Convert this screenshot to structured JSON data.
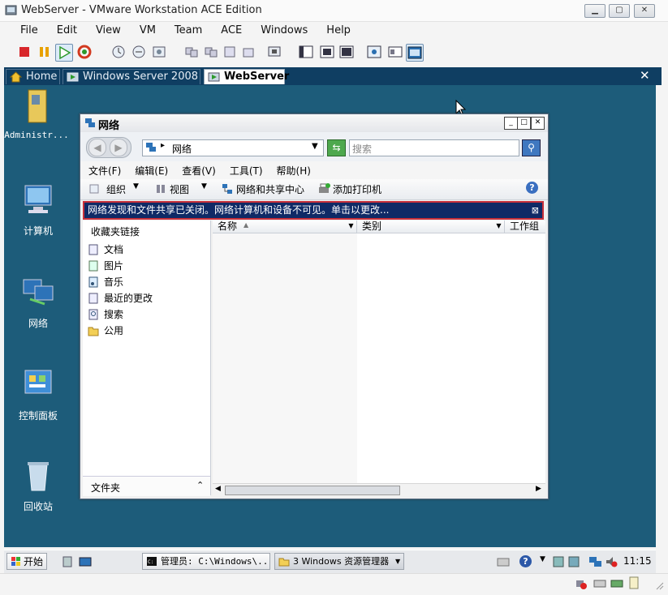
{
  "window": {
    "title": "WebServer - VMware Workstation ACE Edition"
  },
  "menu": [
    "File",
    "Edit",
    "View",
    "VM",
    "Team",
    "ACE",
    "Windows",
    "Help"
  ],
  "tabs": [
    {
      "label": "Home"
    },
    {
      "label": "Windows Server 2008"
    },
    {
      "label": "WebServer"
    }
  ],
  "desktop_icons": [
    {
      "label": "Administr..."
    },
    {
      "label": "计算机"
    },
    {
      "label": "网络"
    },
    {
      "label": "控制面板"
    },
    {
      "label": "回收站"
    }
  ],
  "explorer": {
    "title": "网络",
    "address": "网络",
    "search_placeholder": "搜索",
    "menu": [
      "文件(F)",
      "编辑(E)",
      "查看(V)",
      "工具(T)",
      "帮助(H)"
    ],
    "commands": [
      "组织",
      "视图",
      "网络和共享中心",
      "添加打印机"
    ],
    "infobar": "网络发现和文件共享已关闭。网络计算机和设备不可见。单击以更改...",
    "favorites_header": "收藏夹链接",
    "nav_items": [
      "文档",
      "图片",
      "音乐",
      "最近的更改",
      "搜索",
      "公用"
    ],
    "folders_label": "文件夹",
    "columns": [
      "名称",
      "类别",
      "工作组"
    ]
  },
  "taskbar": {
    "start": "开始",
    "tasks": [
      "管理员: C:\\Windows\\...",
      "3 Windows 资源管理器"
    ],
    "time": "11:15"
  },
  "colors": {
    "desktop": "#1d5c7a",
    "infobar": "#0f2a66",
    "infobar_border": "#c8303a",
    "tabstrip": "#0f3e62"
  }
}
